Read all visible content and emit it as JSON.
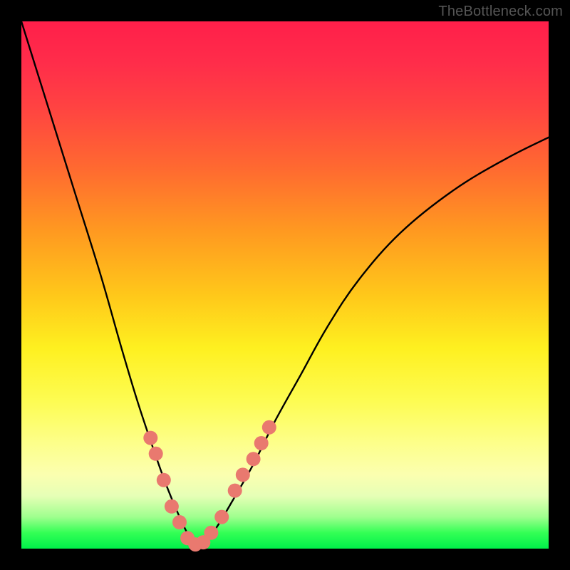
{
  "watermark": "TheBottleneck.com",
  "colors": {
    "frame": "#000000",
    "gradient_top": "#ff1f4a",
    "gradient_bottom": "#00f04a",
    "curve": "#000000",
    "dots": "#e9796f"
  },
  "chart_data": {
    "type": "line",
    "title": "",
    "xlabel": "",
    "ylabel": "",
    "xlim": [
      0,
      100
    ],
    "ylim": [
      0,
      100
    ],
    "series": [
      {
        "name": "bottleneck-curve",
        "x": [
          0,
          5,
          10,
          15,
          19,
          22,
          25,
          27.5,
          30,
          32,
          33.5,
          35,
          37,
          40,
          44,
          48,
          53,
          58,
          64,
          72,
          82,
          92,
          100
        ],
        "y": [
          100,
          84,
          68,
          52,
          38,
          28,
          19,
          12,
          6,
          2,
          0.5,
          1.5,
          4,
          9,
          16,
          24,
          33,
          42,
          51,
          60,
          68,
          74,
          78
        ]
      }
    ],
    "markers": {
      "name": "highlight-dots",
      "x": [
        24.5,
        25.5,
        27,
        28.5,
        30,
        31.5,
        33,
        34.5,
        36,
        38,
        40.5,
        42,
        44,
        45.5,
        47
      ],
      "y": [
        21,
        18,
        13,
        8,
        5,
        2,
        0.8,
        1.2,
        3,
        6,
        11,
        14,
        17,
        20,
        23
      ]
    }
  }
}
